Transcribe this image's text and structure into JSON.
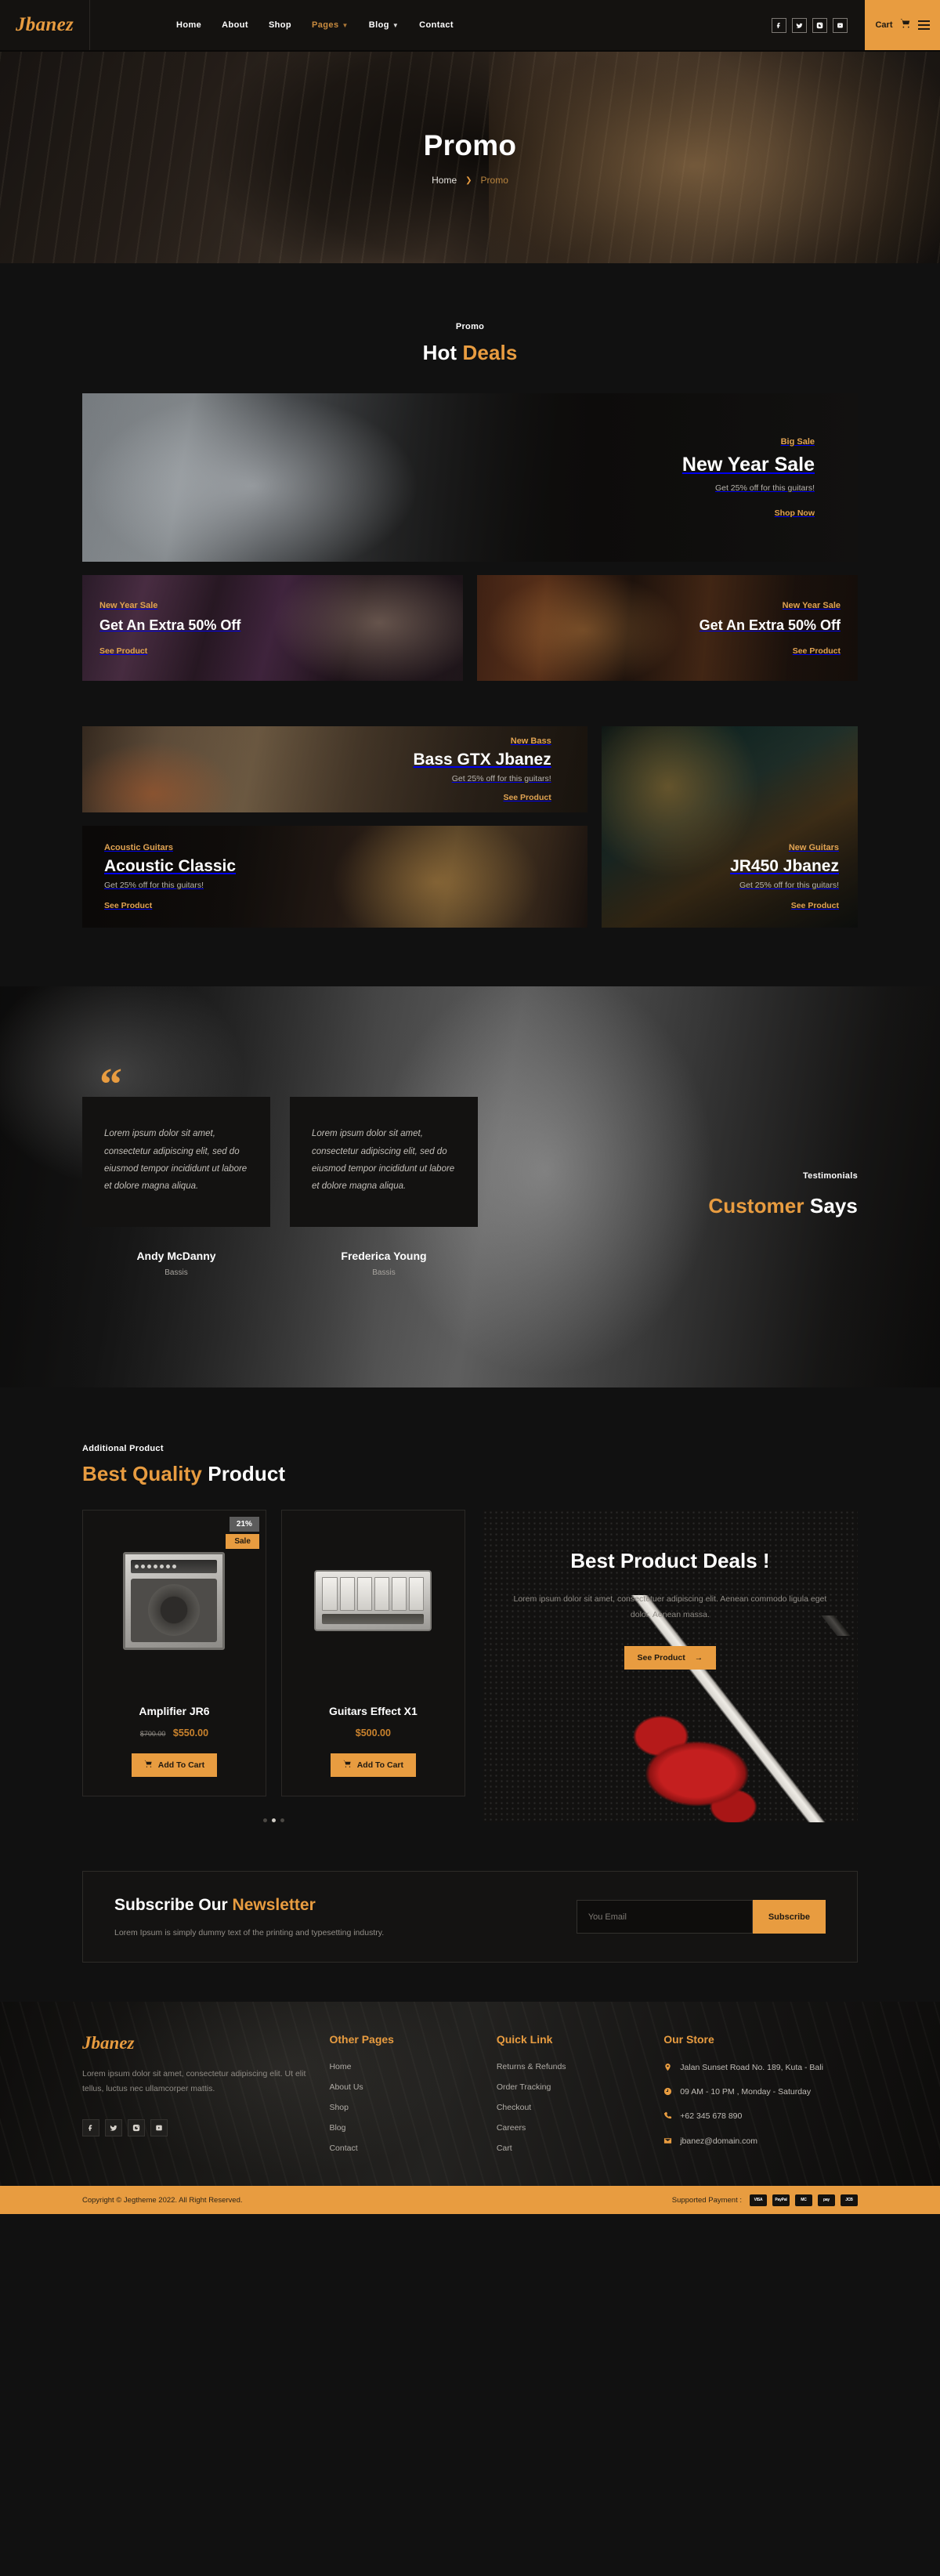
{
  "brand": {
    "name": "Jbanez"
  },
  "header": {
    "nav": [
      {
        "label": "Home",
        "dropdown": false,
        "active": false
      },
      {
        "label": "About",
        "dropdown": false,
        "active": false
      },
      {
        "label": "Shop",
        "dropdown": false,
        "active": false
      },
      {
        "label": "Pages",
        "dropdown": true,
        "active": true
      },
      {
        "label": "Blog",
        "dropdown": true,
        "active": false
      },
      {
        "label": "Contact",
        "dropdown": false,
        "active": false
      }
    ],
    "socials": [
      "facebook-icon",
      "twitter-icon",
      "instagram-icon",
      "youtube-icon"
    ],
    "cart_label": "Cart",
    "cart_icon": "shopping-cart-icon",
    "menu_icon": "hamburger-menu-icon"
  },
  "hero": {
    "title": "Promo",
    "breadcrumb": {
      "home": "Home",
      "separator": "❯",
      "current": "Promo"
    }
  },
  "hot_deals": {
    "kicker": "Promo",
    "title_accent": "Hot",
    "title_rest": "Deals",
    "banner_big": {
      "kicker": "Big Sale",
      "title": "New Year Sale",
      "subtitle": "Get 25% off for this guitars!",
      "link": "Shop Now"
    },
    "banners_half": [
      {
        "kicker": "New Year Sale",
        "title": "Get An Extra 50% Off",
        "link": "See Product"
      },
      {
        "kicker": "New Year Sale",
        "title": "Get An Extra 50% Off",
        "link": "See Product"
      }
    ],
    "bass": {
      "kicker": "New Bass",
      "title": "Bass GTX Jbanez",
      "subtitle": "Get 25% off for this guitars!",
      "link": "See Product"
    },
    "acoustic": {
      "kicker": "Acoustic Guitars",
      "title": "Acoustic Classic",
      "subtitle": "Get 25% off for this guitars!",
      "link": "See Product"
    },
    "jr450": {
      "kicker": "New Guitars",
      "title": "JR450 Jbanez",
      "subtitle": "Get 25% off for this guitars!",
      "link": "See Product"
    }
  },
  "testimonials": {
    "kicker": "Testimonials",
    "title_accent": "Customer",
    "title_rest": "Says",
    "quote_mark": "“",
    "cards": [
      {
        "text": "Lorem ipsum dolor sit amet, consectetur adipiscing elit, sed do eiusmod tempor incididunt ut labore et dolore magna aliqua.",
        "name": "Andy McDanny",
        "role": "Bassis"
      },
      {
        "text": "Lorem ipsum dolor sit amet, consectetur adipiscing elit, sed do eiusmod tempor incididunt ut labore et dolore magna aliqua.",
        "name": "Frederica Young",
        "role": "Bassis"
      }
    ]
  },
  "best_quality": {
    "kicker": "Additional Product",
    "title_accent": "Best Quality",
    "title_rest": "Product",
    "products": [
      {
        "name": "Amplifier JR6",
        "discount_badge": "21%",
        "sale_badge": "Sale",
        "old_price": "$700.00",
        "price": "$550.00",
        "add_label": "Add To Cart",
        "image": "guitar-amplifier-image"
      },
      {
        "name": "Guitars Effect X1",
        "discount_badge": "",
        "sale_badge": "",
        "old_price": "",
        "price": "$500.00",
        "add_label": "Add To Cart",
        "image": "guitar-effect-pedal-image"
      }
    ],
    "carousel_dots": 3,
    "carousel_active": 1,
    "promo": {
      "title": "Best Product Deals !",
      "text": "Lorem ipsum dolor sit amet, consectetuer adipiscing elit. Aenean commodo ligula eget dolor. Aenean massa.",
      "button": "See Product",
      "button_arrow": "→",
      "art": "red-electric-guitar-image"
    }
  },
  "newsletter": {
    "title_plain": "Subscribe Our",
    "title_accent": "Newsletter",
    "description": "Lorem Ipsum is simply dummy text of the printing and typesetting industry.",
    "email_placeholder": "You Email",
    "email_value": "",
    "button": "Subscribe"
  },
  "footer": {
    "brand": "Jbanez",
    "description": "Lorem ipsum dolor sit amet, consectetur adipiscing elit. Ut elit tellus, luctus nec ullamcorper mattis.",
    "socials": [
      "facebook-icon",
      "twitter-icon",
      "instagram-icon",
      "youtube-icon"
    ],
    "columns": [
      {
        "heading": "Other Pages",
        "links": [
          "Home",
          "About Us",
          "Shop",
          "Blog",
          "Contact"
        ]
      },
      {
        "heading": "Quick Link",
        "links": [
          "Returns & Refunds",
          "Order Tracking",
          "Checkout",
          "Careers",
          "Cart"
        ]
      }
    ],
    "store": {
      "heading": "Our Store",
      "items": [
        {
          "icon": "location-pin-icon",
          "text": "Jalan Sunset Road No. 189, Kuta - Bali"
        },
        {
          "icon": "clock-icon",
          "text": "09 AM - 10 PM , Monday - Saturday"
        },
        {
          "icon": "phone-icon",
          "text": "+62 345 678 890"
        },
        {
          "icon": "envelope-icon",
          "text": "jbanez@domain.com"
        }
      ]
    }
  },
  "bottom": {
    "copyright": "Copyright © Jegtheme 2022. All Right Reserved.",
    "payment_label": "Supported Payment :",
    "payment_methods": [
      "VISA",
      "PayPal",
      "MC",
      "pay",
      "JCB"
    ]
  },
  "colors": {
    "accent": "#e89c40",
    "bg": "#111111",
    "card": "#131211"
  }
}
